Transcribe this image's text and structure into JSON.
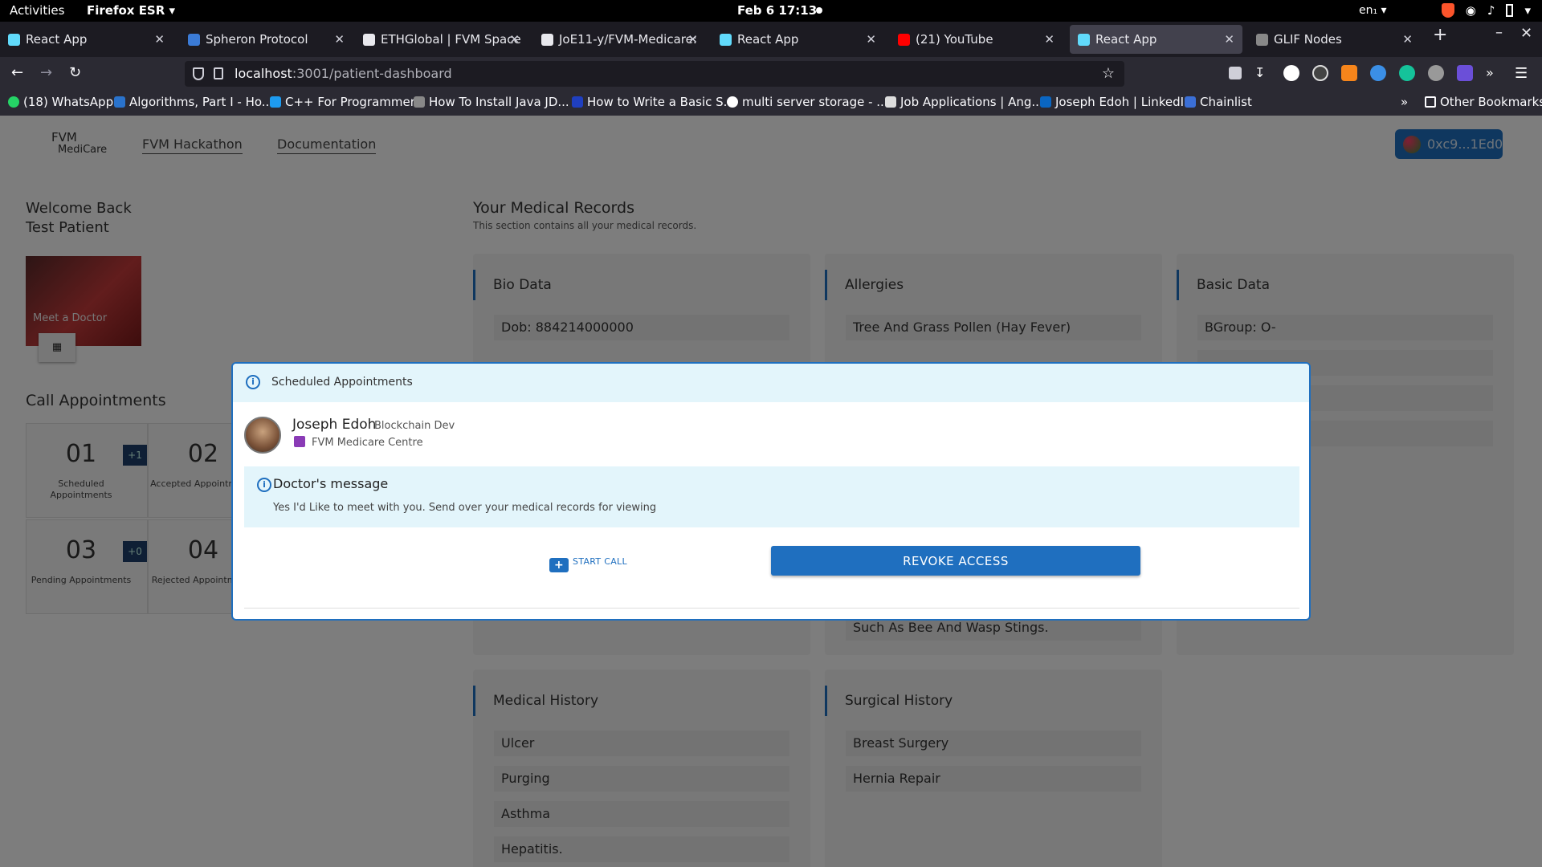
{
  "os_bar": {
    "activities": "Activities",
    "app_name": "Firefox ESR",
    "clock": "Feb 6  17:13",
    "lang": "en₁"
  },
  "tabs": [
    {
      "label": "React App",
      "color": "#61dafb"
    },
    {
      "label": "Spheron Protocol",
      "color": "#3b7bd6"
    },
    {
      "label": "ETHGlobal | FVM Space",
      "color": "#e8e8ed"
    },
    {
      "label": "JoE11-y/FVM-Medicare:",
      "color": "#e8e8ed"
    },
    {
      "label": "React App",
      "color": "#61dafb"
    },
    {
      "label": "(21) YouTube",
      "color": "#ff0000"
    },
    {
      "label": "React App",
      "color": "#61dafb",
      "active": true
    },
    {
      "label": "GLIF Nodes",
      "color": "#888888"
    }
  ],
  "urlbar": {
    "host": "localhost",
    "path": ":3001/patient-dashboard"
  },
  "bookmarks": [
    {
      "label": "(18) WhatsApp",
      "color": "#25d366"
    },
    {
      "label": "Algorithms, Part I - Ho...",
      "color": "#2a73cc"
    },
    {
      "label": "C++ For Programmers",
      "color": "#1d9bf0"
    },
    {
      "label": "How To Install Java JD...",
      "color": "#888888"
    },
    {
      "label": "How to Write a Basic S...",
      "color": "#1f3fbf"
    },
    {
      "label": "multi server storage - ...",
      "color": "#ffffff"
    },
    {
      "label": "Job Applications | Ang...",
      "color": "#dddddd"
    },
    {
      "label": "Joseph Edoh | LinkedIn",
      "color": "#0a66c2"
    },
    {
      "label": "Chainlist",
      "color": "#3b6fd6"
    }
  ],
  "other_bookmarks": "Other Bookmarks",
  "app": {
    "logo_line1": "FVM",
    "logo_line2": "MediCare",
    "nav": [
      "FVM Hackathon",
      "Documentation"
    ],
    "wallet": "0xc9...1Ed0",
    "welcome_line1": "Welcome Back",
    "welcome_line2": "Test Patient",
    "meet_doctor": "Meet a Doctor",
    "call_title": "Call Appointments",
    "stats": [
      {
        "num": "01",
        "caption": "Scheduled Appointments",
        "badge": "+1"
      },
      {
        "num": "02",
        "caption": "Accepted Appointments",
        "badge": ""
      },
      {
        "num": "03",
        "caption": "Pending Appointments",
        "badge": "+0"
      },
      {
        "num": "04",
        "caption": "Rejected Appointments",
        "badge": ""
      }
    ],
    "records_title": "Your Medical Records",
    "records_subtitle": "This section contains all your medical records.",
    "cards": [
      {
        "title": "Bio Data",
        "rows": [
          "Dob: 884214000000"
        ]
      },
      {
        "title": "Allergies",
        "rows": [
          "Tree And Grass Pollen (Hay Fever)",
          "Such As Bee And Wasp Stings."
        ]
      },
      {
        "title": "Basic Data",
        "rows": [
          "BGroup: O-"
        ]
      },
      {
        "title": "Medical History",
        "rows": [
          "Ulcer",
          "Purging",
          "Asthma",
          "Hepatitis."
        ]
      },
      {
        "title": "Surgical History",
        "rows": [
          "Breast Surgery",
          "Hernia Repair"
        ]
      }
    ]
  },
  "modal": {
    "title": "Scheduled Appointments",
    "doctor_name": "Joseph Edoh",
    "doctor_role": "Blockchain Dev",
    "hospital": "FVM Medicare Centre",
    "message_title": "Doctor's message",
    "message_body": "Yes I'd Like to meet with you. Send over your medical records for viewing",
    "start_call": "START CALL",
    "revoke": "REVOKE ACCESS"
  }
}
